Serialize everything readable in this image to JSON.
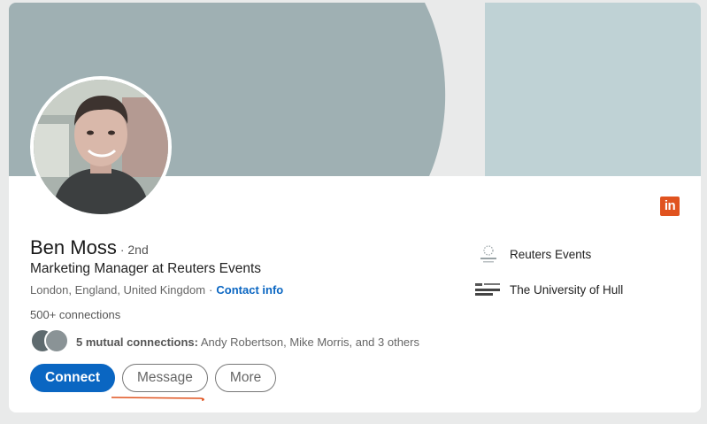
{
  "profile": {
    "name": "Ben Moss",
    "degree": "· 2nd",
    "headline": "Marketing Manager at Reuters Events",
    "location": "London, England, United Kingdom",
    "separator": "·",
    "contact_info": "Contact info",
    "connections": "500+ connections",
    "mutual_count": "5 mutual connections:",
    "mutual_names": "Andy Robertson, Mike Morris, and 3 others"
  },
  "actions": {
    "connect": "Connect",
    "message": "Message",
    "more": "More"
  },
  "experience": [
    {
      "name": "Reuters Events",
      "logo_icon": "reuters-events-logo"
    },
    {
      "name": "The University of Hull",
      "logo_icon": "university-of-hull-logo"
    }
  ],
  "colors": {
    "accent": "#0a66c2",
    "linkedin_badge": "#e0531f",
    "annotation_underline": "#e0531f"
  }
}
